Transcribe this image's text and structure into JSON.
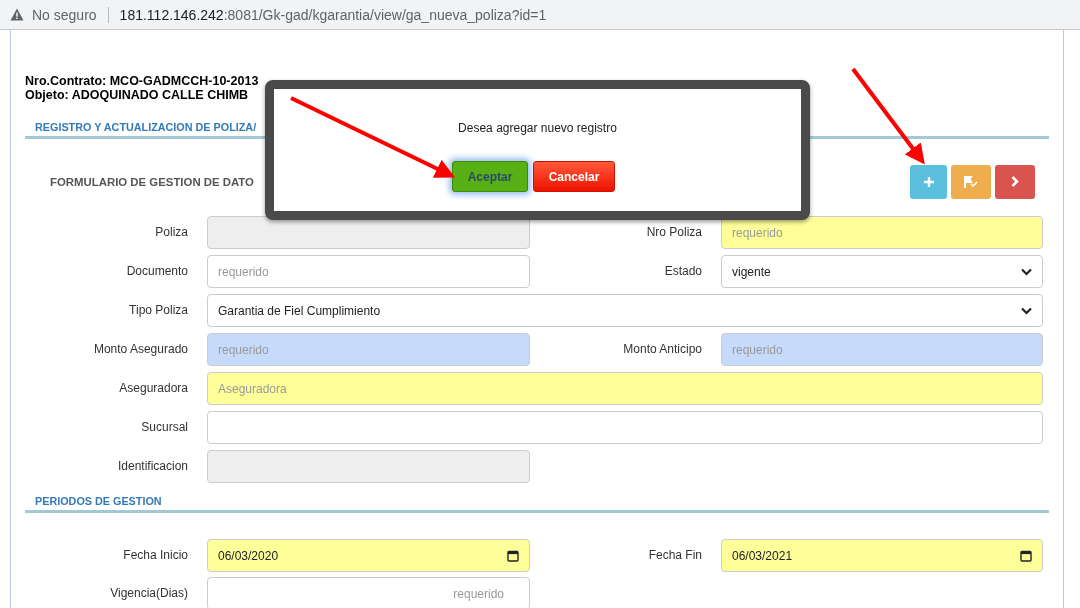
{
  "browser": {
    "security": "No seguro",
    "url_host": "181.112.146.242",
    "url_rest": ":8081/Gk-gad/kgarantia/view/ga_nueva_poliza?id=1"
  },
  "header": {
    "contract": "Nro.Contrato: MCO-GADMCCH-10-2013",
    "object": "Objeto: ADOQUINADO CALLE CHIMB"
  },
  "section_title": "REGISTRO Y ACTUALIZACION DE POLIZA/",
  "form_title": "FORMULARIO DE GESTION DE DATO",
  "toolbar": [
    {
      "kind": "add"
    },
    {
      "kind": "save"
    },
    {
      "kind": "next"
    }
  ],
  "rows": [
    {
      "fields": [
        {
          "label": "Poliza",
          "kind": "text",
          "color": "#eeeeee"
        },
        {
          "label": "Nro Poliza",
          "kind": "text",
          "color": "#ffff99",
          "placeholder": "requerido"
        }
      ]
    },
    {
      "fields": [
        {
          "label": "Documento",
          "kind": "text",
          "color": "#ffffff",
          "placeholder": "requerido"
        },
        {
          "label": "Estado",
          "kind": "select",
          "color": "#ffffff",
          "value": "vigente"
        }
      ]
    },
    {
      "fields": [
        {
          "label": "Tipo Poliza",
          "kind": "select",
          "color": "#ffffff",
          "value": "Garantia de Fiel Cumplimiento",
          "wide": true
        }
      ]
    },
    {
      "fields": [
        {
          "label": "Monto Asegurado",
          "kind": "text",
          "color": "#c6dbfb",
          "placeholder": "requerido"
        },
        {
          "label": "Monto Anticipo",
          "kind": "text",
          "color": "#c6dbfb",
          "placeholder": "requerido"
        }
      ]
    },
    {
      "fields": [
        {
          "label": "Aseguradora",
          "kind": "text",
          "color": "#ffff99",
          "placeholder": "Aseguradora",
          "wide": true
        }
      ]
    },
    {
      "fields": [
        {
          "label": "Sucursal",
          "kind": "text",
          "color": "#ffffff",
          "wide": true
        }
      ]
    },
    {
      "fields": [
        {
          "label": "Identificacion",
          "kind": "text",
          "color": "#eeeeee"
        }
      ]
    }
  ],
  "periods_title": "PERIODOS DE GESTION",
  "period_rows": [
    {
      "fields": [
        {
          "label": "Fecha Inicio",
          "kind": "date",
          "color": "#ffff99",
          "value": "06/03/2020"
        },
        {
          "label": "Fecha Fin",
          "kind": "date",
          "color": "#ffff99",
          "value": "06/03/2021"
        }
      ]
    },
    {
      "fields": [
        {
          "label": "Vigencia(Dias)",
          "kind": "number",
          "color": "#ffffff",
          "placeholder": "requerido"
        }
      ]
    }
  ],
  "modal": {
    "message": "Desea agregar nuevo registro",
    "buttons": [
      {
        "label": "Aceptar",
        "kind": "confirm",
        "focused": true
      },
      {
        "label": "Cancelar",
        "kind": "cancel",
        "focused": false
      }
    ]
  }
}
